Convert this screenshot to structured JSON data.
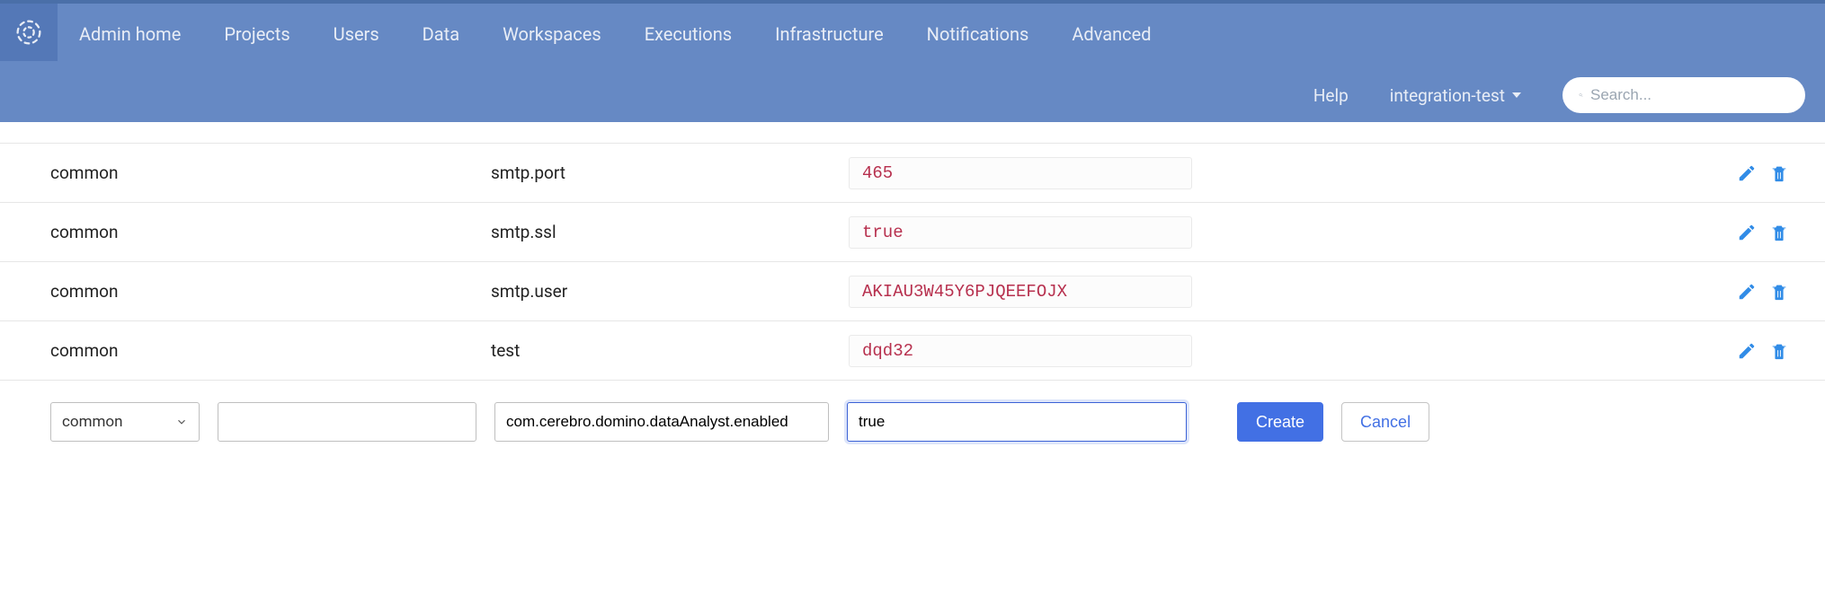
{
  "header": {
    "nav1": [
      "Admin home",
      "Projects",
      "Users",
      "Data",
      "Workspaces",
      "Executions",
      "Infrastructure",
      "Notifications",
      "Advanced"
    ],
    "help": "Help",
    "user": "integration-test",
    "search_placeholder": "Search..."
  },
  "rows": [
    {
      "namespace": "common",
      "key": "smtp.port",
      "value": "465"
    },
    {
      "namespace": "common",
      "key": "smtp.ssl",
      "value": "true"
    },
    {
      "namespace": "common",
      "key": "smtp.user",
      "value": "AKIAU3W45Y6PJQEEFOJX"
    },
    {
      "namespace": "common",
      "key": "test",
      "value": "dqd32"
    }
  ],
  "form": {
    "namespace_selected": "common",
    "blank_input": "",
    "key_input": "com.cerebro.domino.dataAnalyst.enabled",
    "value_input": "true",
    "create_label": "Create",
    "cancel_label": "Cancel"
  }
}
